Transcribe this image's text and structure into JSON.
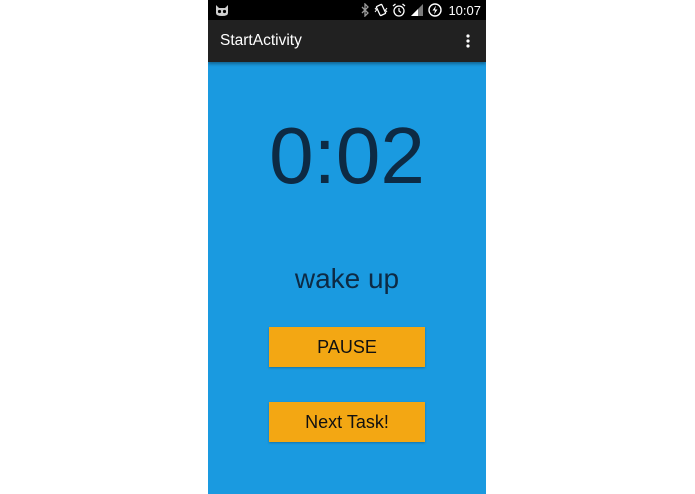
{
  "status_bar": {
    "time": "10:07"
  },
  "action_bar": {
    "title": "StartActivity"
  },
  "timer": {
    "value": "0:02"
  },
  "task": {
    "label": "wake up"
  },
  "buttons": {
    "pause_label": "PAUSE",
    "next_label": "Next Task!"
  },
  "colors": {
    "background": "#1a9ae0",
    "action_bar": "#212121",
    "button": "#f3a713",
    "text_dark": "#0d2a44"
  },
  "icons": [
    "cat-app-icon",
    "bluetooth-icon",
    "vibrate-icon",
    "alarm-icon",
    "signal-icon",
    "battery-charging-icon",
    "overflow-menu-icon"
  ]
}
